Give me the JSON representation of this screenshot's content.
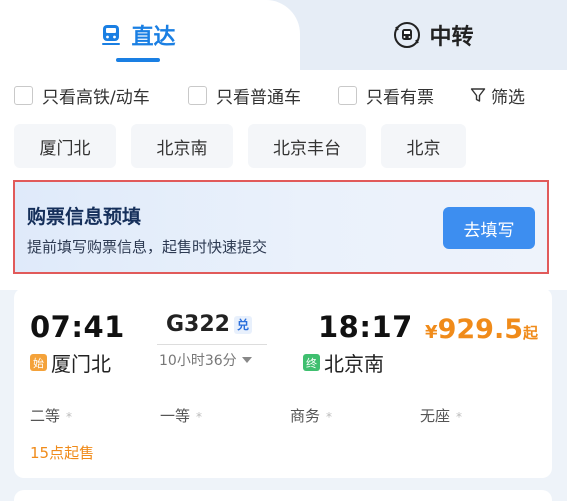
{
  "tabs": {
    "direct": "直达",
    "transfer": "中转"
  },
  "filters": [
    "只看高铁/动车",
    "只看普通车",
    "只看有票"
  ],
  "filter_button": "筛选",
  "stations": [
    "厦门北",
    "北京南",
    "北京丰台",
    "北京"
  ],
  "banner": {
    "title": "购票信息预填",
    "subtitle": "提前填写购票信息，起售时快速提交",
    "button": "去填写"
  },
  "train": {
    "depart_time": "07:41",
    "depart_station": "厦门北",
    "depart_badge": "始",
    "train_no": "G322",
    "train_badge": "兑",
    "duration": "10小时36分",
    "arrive_time": "18:17",
    "arrive_station": "北京南",
    "arrive_badge": "终",
    "price_currency": "¥",
    "price": "929.5",
    "price_suffix": "起",
    "seats": [
      {
        "name": "二等",
        "mark": "*"
      },
      {
        "name": "一等",
        "mark": "*"
      },
      {
        "name": "商务",
        "mark": "*"
      },
      {
        "name": "无座",
        "mark": "*"
      }
    ],
    "sale_note": "15点起售"
  },
  "colors": {
    "accent": "#1a7fe3",
    "price": "#f08b1a",
    "highlight_border": "#e15a5a",
    "depart_badge": "#f4a23a",
    "arrive_badge": "#3fbf6f"
  }
}
